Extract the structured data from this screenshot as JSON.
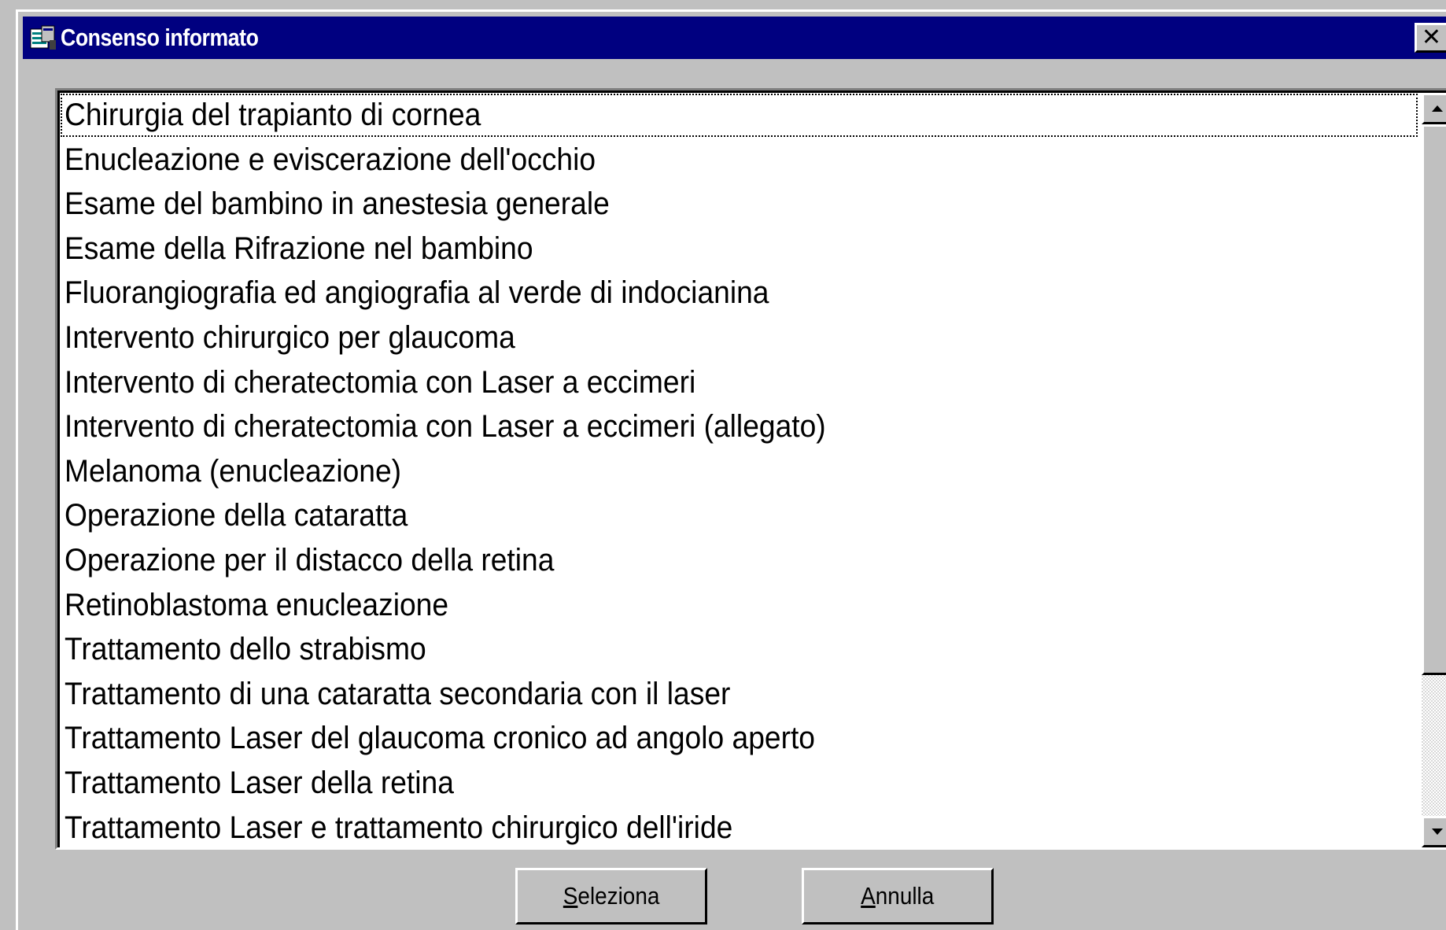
{
  "window": {
    "title": "Consenso informato",
    "title_icon": "app-window-icon",
    "close_label": "✕"
  },
  "list": {
    "items": [
      "Chirurgia del trapianto di cornea",
      "Enucleazione e eviscerazione dell'occhio",
      "Esame del bambino in anestesia generale",
      "Esame della Rifrazione nel bambino",
      "Fluorangiografia ed angiografia al verde di indocianina",
      "Intervento chirurgico per glaucoma",
      "Intervento di cheratectomia con Laser a eccimeri",
      "Intervento di cheratectomia con Laser a eccimeri (allegato)",
      "Melanoma (enucleazione)",
      "Operazione della cataratta",
      "Operazione per il distacco della retina",
      "Retinoblastoma enucleazione",
      "Trattamento dello strabismo",
      "Trattamento di una cataratta secondaria con il laser",
      "Trattamento Laser del glaucoma cronico ad angolo aperto",
      "Trattamento Laser della retina",
      "Trattamento Laser e trattamento chirurgico dell'iride"
    ],
    "focused_index": 0
  },
  "buttons": {
    "select": {
      "accel": "S",
      "rest": "eleziona"
    },
    "cancel": {
      "accel": "A",
      "rest": "nnulla"
    }
  },
  "colors": {
    "titlebar": "#000080",
    "face": "#c0c0c0",
    "list_bg": "#ffffff"
  }
}
